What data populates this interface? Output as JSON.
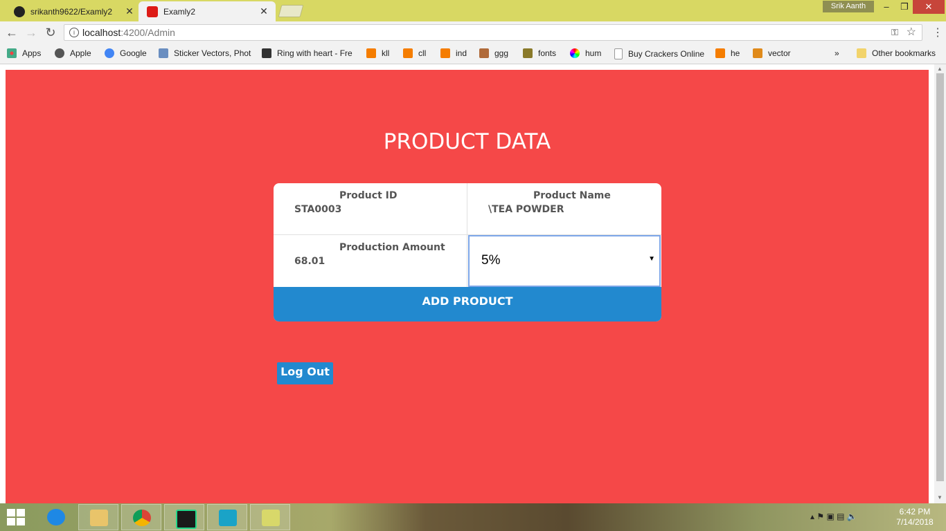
{
  "browser": {
    "tabs": [
      {
        "title": "srikanth9622/Examly2",
        "icon": "github-icon",
        "active": false
      },
      {
        "title": "Examly2",
        "icon": "angular-icon",
        "active": true
      }
    ],
    "profile": "Srik Aanth",
    "url_host": "localhost",
    "url_path": ":4200/Admin",
    "bookmarks": [
      {
        "label": "Apps",
        "icon": "apps-grid-icon",
        "color": "#e44"
      },
      {
        "label": "Apple",
        "icon": "apple-icon",
        "color": "#555"
      },
      {
        "label": "Google",
        "icon": "google-icon",
        "color": "#4285f4"
      },
      {
        "label": "Sticker Vectors, Phot",
        "icon": "image-icon",
        "color": "#6a8ec0"
      },
      {
        "label": "Ring with heart - Fre",
        "icon": "vector-icon",
        "color": "#333"
      },
      {
        "label": "kll",
        "icon": "blogger-icon",
        "color": "#f57d00"
      },
      {
        "label": "cll",
        "icon": "blogger-icon",
        "color": "#f57d00"
      },
      {
        "label": "ind",
        "icon": "blogger-icon",
        "color": "#f57d00"
      },
      {
        "label": "ggg",
        "icon": "site-icon",
        "color": "#b06a3a"
      },
      {
        "label": "fonts",
        "icon": "font-icon",
        "color": "#8a7a2a"
      },
      {
        "label": "hum",
        "icon": "color-wheel-icon",
        "color": "#c040c0"
      },
      {
        "label": "Buy Crackers Online",
        "icon": "page-icon",
        "color": "#999"
      },
      {
        "label": "he",
        "icon": "blogger-icon",
        "color": "#f57d00"
      },
      {
        "label": "vector",
        "icon": "v-icon",
        "color": "#e08a1a"
      }
    ],
    "overflow": "»",
    "other_bookmarks": "Other bookmarks"
  },
  "page": {
    "background": "#f54848",
    "title": "PRODUCT DATA",
    "fields": {
      "product_id_label": "Product ID",
      "product_id_value": "STA0003",
      "product_name_label": "Product Name",
      "product_name_value": "\\TEA POWDER",
      "production_amount_label": "Production Amount",
      "production_amount_value": "68.01",
      "discount_select_value": "5%"
    },
    "add_button": "ADD PRODUCT",
    "logout_button": "Log Out",
    "accent": "#2289cf"
  },
  "taskbar": {
    "apps": [
      {
        "name": "internet-explorer-icon",
        "color": "#1e88e5"
      },
      {
        "name": "file-explorer-icon",
        "color": "#e9c46a"
      },
      {
        "name": "chrome-icon",
        "color": "#db4437"
      },
      {
        "name": "webstorm-icon",
        "color": "#1a1a1a"
      },
      {
        "name": "camera-app-icon",
        "color": "#1aa3c7"
      },
      {
        "name": "sticky-notes-icon",
        "color": "#d8d86a"
      }
    ],
    "time": "6:42 PM",
    "date": "7/14/2018"
  }
}
